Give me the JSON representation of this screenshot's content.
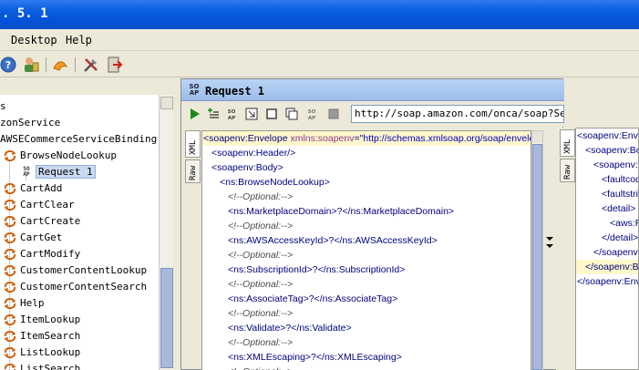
{
  "window": {
    "title": ". 5. 1"
  },
  "menu": {
    "desktop": "Desktop",
    "help": "Help"
  },
  "tree": {
    "items": [
      {
        "label": "s",
        "indent": 0
      },
      {
        "label": "zonService",
        "indent": 0
      },
      {
        "label": "AWSECommerceServiceBinding",
        "indent": 0
      },
      {
        "label": "BrowseNodeLookup",
        "indent": 1,
        "icon": "operation-icon"
      },
      {
        "label": "Request 1",
        "indent": 2,
        "icon": "soap-request-icon",
        "selected": true
      },
      {
        "label": "CartAdd",
        "indent": 1,
        "icon": "operation-icon"
      },
      {
        "label": "CartClear",
        "indent": 1,
        "icon": "operation-icon"
      },
      {
        "label": "CartCreate",
        "indent": 1,
        "icon": "operation-icon"
      },
      {
        "label": "CartGet",
        "indent": 1,
        "icon": "operation-icon"
      },
      {
        "label": "CartModify",
        "indent": 1,
        "icon": "operation-icon"
      },
      {
        "label": "CustomerContentLookup",
        "indent": 1,
        "icon": "operation-icon"
      },
      {
        "label": "CustomerContentSearch",
        "indent": 1,
        "icon": "operation-icon"
      },
      {
        "label": "Help",
        "indent": 1,
        "icon": "operation-icon"
      },
      {
        "label": "ItemLookup",
        "indent": 1,
        "icon": "operation-icon"
      },
      {
        "label": "ItemSearch",
        "indent": 1,
        "icon": "operation-icon"
      },
      {
        "label": "ListLookup",
        "indent": 1,
        "icon": "operation-icon"
      },
      {
        "label": "ListSearch",
        "indent": 1,
        "icon": "operation-icon"
      }
    ]
  },
  "request": {
    "soap_tag_top": "SO",
    "soap_tag_bottom": "AP",
    "title": "Request 1",
    "url": "http://soap.amazon.com/onca/soap?Service=AWSECommerceService",
    "tabs": {
      "xml": "XML",
      "raw": "Raw"
    },
    "code": [
      {
        "parts": [
          [
            "tag",
            "<soapenv:Envelope "
          ],
          [
            "attr",
            "xmlns:soapenv"
          ],
          [
            "tag",
            "="
          ],
          [
            "val",
            "\"http://schemas.xmlsoap.org/soap/envelope/\""
          ]
        ],
        "indent": 0,
        "hl": true
      },
      {
        "parts": [
          [
            "tag",
            "<soapenv:Header/>"
          ]
        ],
        "indent": 1
      },
      {
        "parts": [
          [
            "tag",
            "<soapenv:Body>"
          ]
        ],
        "indent": 1
      },
      {
        "parts": [
          [
            "tag",
            "<ns:BrowseNodeLookup>"
          ]
        ],
        "indent": 2
      },
      {
        "parts": [
          [
            "cmt",
            "<!--Optional:-->"
          ]
        ],
        "indent": 3
      },
      {
        "parts": [
          [
            "tag",
            "<ns:MarketplaceDomain>?</ns:MarketplaceDomain>"
          ]
        ],
        "indent": 3
      },
      {
        "parts": [
          [
            "cmt",
            "<!--Optional:-->"
          ]
        ],
        "indent": 3
      },
      {
        "parts": [
          [
            "tag",
            "<ns:AWSAccessKeyId>?</ns:AWSAccessKeyId>"
          ]
        ],
        "indent": 3
      },
      {
        "parts": [
          [
            "cmt",
            "<!--Optional:-->"
          ]
        ],
        "indent": 3
      },
      {
        "parts": [
          [
            "tag",
            "<ns:SubscriptionId>?</ns:SubscriptionId>"
          ]
        ],
        "indent": 3
      },
      {
        "parts": [
          [
            "cmt",
            "<!--Optional:-->"
          ]
        ],
        "indent": 3
      },
      {
        "parts": [
          [
            "tag",
            "<ns:AssociateTag>?</ns:AssociateTag>"
          ]
        ],
        "indent": 3
      },
      {
        "parts": [
          [
            "cmt",
            "<!--Optional:-->"
          ]
        ],
        "indent": 3
      },
      {
        "parts": [
          [
            "tag",
            "<ns:Validate>?</ns:Validate>"
          ]
        ],
        "indent": 3
      },
      {
        "parts": [
          [
            "cmt",
            "<!--Optional:-->"
          ]
        ],
        "indent": 3
      },
      {
        "parts": [
          [
            "tag",
            "<ns:XMLEscaping>?</ns:XMLEscaping>"
          ]
        ],
        "indent": 3
      },
      {
        "parts": [
          [
            "cmt",
            "<!--Optional:-->"
          ]
        ],
        "indent": 3
      }
    ]
  },
  "response": {
    "tabs": {
      "xml": "XML",
      "raw": "Raw"
    },
    "code": [
      {
        "text": "<soapenv:Envelope",
        "indent": 0
      },
      {
        "text": "<soapenv:Body>",
        "indent": 1
      },
      {
        "text": "<soapenv:Fault>",
        "indent": 2
      },
      {
        "text": "<faultcode>",
        "indent": 3
      },
      {
        "text": "<faultstring>",
        "indent": 3
      },
      {
        "text": "<detail>",
        "indent": 3
      },
      {
        "text": "<aws:RequestId>",
        "indent": 4
      },
      {
        "text": "</detail>",
        "indent": 3
      },
      {
        "text": "</soapenv:Fault>",
        "indent": 2
      },
      {
        "text": "</soapenv:Body>",
        "indent": 1,
        "hl": true
      },
      {
        "text": "</soapenv:Envelope>",
        "indent": 0
      }
    ]
  }
}
